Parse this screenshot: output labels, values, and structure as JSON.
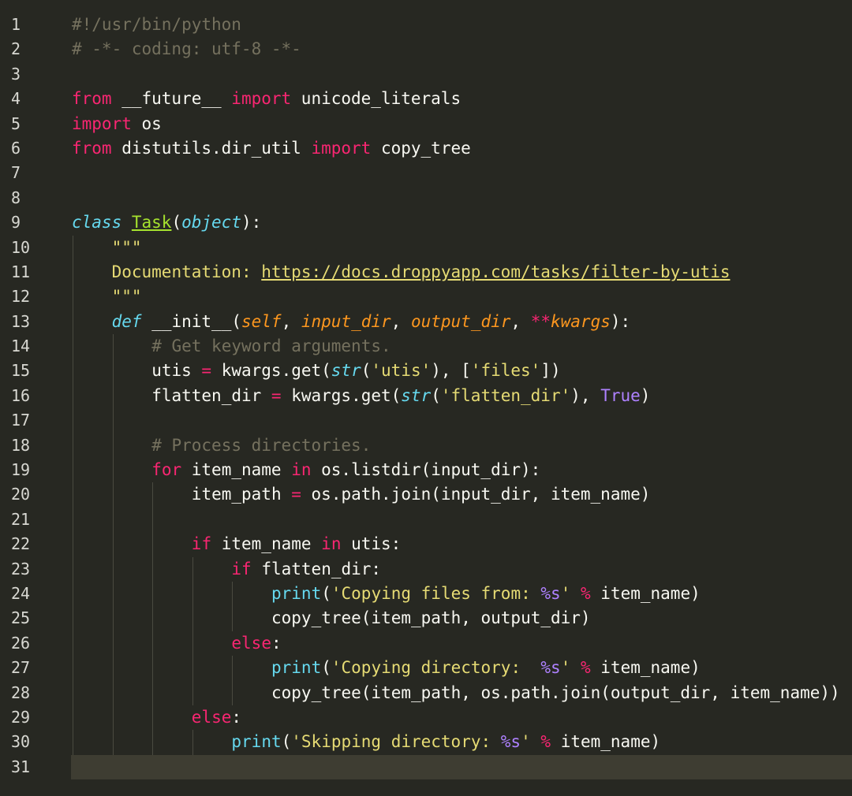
{
  "editor": {
    "theme_colors": {
      "background": "#272822",
      "comment": "#75715e",
      "keyword": "#f92672",
      "string": "#e6db74",
      "builtin": "#66d9ef",
      "param": "#fd971f",
      "constant": "#ae81ff",
      "class_name": "#a6e22e",
      "current_line": "#3e3d32"
    },
    "current_line": 31,
    "lines": [
      {
        "n": "1",
        "indent": 0,
        "tokens": [
          [
            "c",
            "#!/usr/bin/python"
          ]
        ]
      },
      {
        "n": "2",
        "indent": 0,
        "tokens": [
          [
            "c",
            "# -*- coding: utf-8 -*-"
          ]
        ]
      },
      {
        "n": "3",
        "indent": 0,
        "tokens": []
      },
      {
        "n": "4",
        "indent": 0,
        "tokens": [
          [
            "k",
            "from"
          ],
          [
            "n",
            " __future__ "
          ],
          [
            "k",
            "import"
          ],
          [
            "n",
            " unicode_literals"
          ]
        ]
      },
      {
        "n": "5",
        "indent": 0,
        "tokens": [
          [
            "k",
            "import"
          ],
          [
            "n",
            " os"
          ]
        ]
      },
      {
        "n": "6",
        "indent": 0,
        "tokens": [
          [
            "k",
            "from"
          ],
          [
            "n",
            " distutils.dir_util "
          ],
          [
            "k",
            "import"
          ],
          [
            "n",
            " copy_tree"
          ]
        ]
      },
      {
        "n": "7",
        "indent": 0,
        "tokens": []
      },
      {
        "n": "8",
        "indent": 0,
        "tokens": []
      },
      {
        "n": "9",
        "indent": 0,
        "tokens": [
          [
            "bi",
            "class"
          ],
          [
            "n",
            " "
          ],
          [
            "cn",
            "Task"
          ],
          [
            "n",
            "("
          ],
          [
            "bi",
            "object"
          ],
          [
            "n",
            "):"
          ]
        ]
      },
      {
        "n": "10",
        "indent": 1,
        "tokens": [
          [
            "s",
            "\"\"\""
          ]
        ]
      },
      {
        "n": "11",
        "indent": 1,
        "tokens": [
          [
            "s",
            "Documentation: "
          ],
          [
            "su",
            "https://docs.droppyapp.com/tasks/filter-by-utis"
          ]
        ]
      },
      {
        "n": "12",
        "indent": 1,
        "tokens": [
          [
            "s",
            "\"\"\""
          ]
        ]
      },
      {
        "n": "13",
        "indent": 1,
        "tokens": [
          [
            "bi",
            "def"
          ],
          [
            "n",
            " "
          ],
          [
            "n",
            "__init__"
          ],
          [
            "n",
            "("
          ],
          [
            "p",
            "self"
          ],
          [
            "n",
            ", "
          ],
          [
            "p",
            "input_dir"
          ],
          [
            "n",
            ", "
          ],
          [
            "p",
            "output_dir"
          ],
          [
            "n",
            ", "
          ],
          [
            "o",
            "**"
          ],
          [
            "p",
            "kwargs"
          ],
          [
            "n",
            "):"
          ]
        ]
      },
      {
        "n": "14",
        "indent": 2,
        "tokens": [
          [
            "c",
            "# Get keyword arguments."
          ]
        ]
      },
      {
        "n": "15",
        "indent": 2,
        "tokens": [
          [
            "n",
            "utis "
          ],
          [
            "o",
            "="
          ],
          [
            "n",
            " kwargs.get("
          ],
          [
            "bi",
            "str"
          ],
          [
            "n",
            "("
          ],
          [
            "s",
            "'utis'"
          ],
          [
            "n",
            "), ["
          ],
          [
            "s",
            "'files'"
          ],
          [
            "n",
            "])"
          ]
        ]
      },
      {
        "n": "16",
        "indent": 2,
        "tokens": [
          [
            "n",
            "flatten_dir "
          ],
          [
            "o",
            "="
          ],
          [
            "n",
            " kwargs.get("
          ],
          [
            "bi",
            "str"
          ],
          [
            "n",
            "("
          ],
          [
            "s",
            "'flatten_dir'"
          ],
          [
            "n",
            "), "
          ],
          [
            "num",
            "True"
          ],
          [
            "n",
            ")"
          ]
        ]
      },
      {
        "n": "17",
        "indent": 2,
        "tokens": []
      },
      {
        "n": "18",
        "indent": 2,
        "tokens": [
          [
            "c",
            "# Process directories."
          ]
        ]
      },
      {
        "n": "19",
        "indent": 2,
        "tokens": [
          [
            "k",
            "for"
          ],
          [
            "n",
            " item_name "
          ],
          [
            "k",
            "in"
          ],
          [
            "n",
            " os.listdir(input_dir):"
          ]
        ]
      },
      {
        "n": "20",
        "indent": 3,
        "tokens": [
          [
            "n",
            "item_path "
          ],
          [
            "o",
            "="
          ],
          [
            "n",
            " os.path.join(input_dir, item_name)"
          ]
        ]
      },
      {
        "n": "21",
        "indent": 3,
        "tokens": []
      },
      {
        "n": "22",
        "indent": 3,
        "tokens": [
          [
            "k",
            "if"
          ],
          [
            "n",
            " item_name "
          ],
          [
            "k",
            "in"
          ],
          [
            "n",
            " utis:"
          ]
        ]
      },
      {
        "n": "23",
        "indent": 4,
        "tokens": [
          [
            "k",
            "if"
          ],
          [
            "n",
            " flatten_dir:"
          ]
        ]
      },
      {
        "n": "24",
        "indent": 5,
        "tokens": [
          [
            "b",
            "print"
          ],
          [
            "n",
            "("
          ],
          [
            "s",
            "'Copying files from: "
          ],
          [
            "num",
            "%s"
          ],
          [
            "s",
            "'"
          ],
          [
            "n",
            " "
          ],
          [
            "o",
            "%"
          ],
          [
            "n",
            " item_name)"
          ]
        ]
      },
      {
        "n": "25",
        "indent": 5,
        "tokens": [
          [
            "n",
            "copy_tree(item_path, output_dir)"
          ]
        ]
      },
      {
        "n": "26",
        "indent": 4,
        "tokens": [
          [
            "k",
            "else"
          ],
          [
            "n",
            ":"
          ]
        ]
      },
      {
        "n": "27",
        "indent": 5,
        "tokens": [
          [
            "b",
            "print"
          ],
          [
            "n",
            "("
          ],
          [
            "s",
            "'Copying directory:  "
          ],
          [
            "num",
            "%s"
          ],
          [
            "s",
            "'"
          ],
          [
            "n",
            " "
          ],
          [
            "o",
            "%"
          ],
          [
            "n",
            " item_name)"
          ]
        ]
      },
      {
        "n": "28",
        "indent": 5,
        "tokens": [
          [
            "n",
            "copy_tree(item_path, os.path.join(output_dir, item_name))"
          ]
        ]
      },
      {
        "n": "29",
        "indent": 3,
        "tokens": [
          [
            "k",
            "else"
          ],
          [
            "n",
            ":"
          ]
        ]
      },
      {
        "n": "30",
        "indent": 4,
        "tokens": [
          [
            "b",
            "print"
          ],
          [
            "n",
            "("
          ],
          [
            "s",
            "'Skipping directory: "
          ],
          [
            "num",
            "%s"
          ],
          [
            "s",
            "'"
          ],
          [
            "n",
            " "
          ],
          [
            "o",
            "%"
          ],
          [
            "n",
            " item_name)"
          ]
        ]
      },
      {
        "n": "31",
        "indent": 0,
        "tokens": []
      }
    ]
  }
}
